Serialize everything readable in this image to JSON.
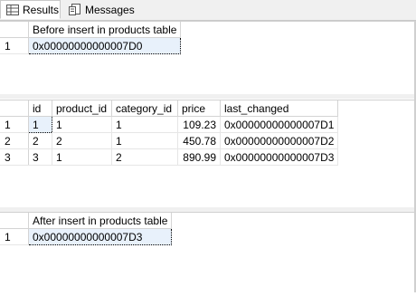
{
  "tabs": [
    {
      "label": "Results"
    },
    {
      "label": "Messages"
    }
  ],
  "grid1": {
    "header": "Before insert in products table",
    "rows": [
      {
        "rownum": "1",
        "value": "0x00000000000007D0"
      }
    ]
  },
  "grid2": {
    "columns": [
      "id",
      "product_id",
      "category_id",
      "price",
      "last_changed"
    ],
    "rows": [
      {
        "rownum": "1",
        "id": "1",
        "product_id": "1",
        "category_id": "1",
        "price": "109.23",
        "last_changed": "0x00000000000007D1"
      },
      {
        "rownum": "2",
        "id": "2",
        "product_id": "2",
        "category_id": "1",
        "price": "450.78",
        "last_changed": "0x00000000000007D2"
      },
      {
        "rownum": "3",
        "id": "3",
        "product_id": "1",
        "category_id": "2",
        "price": "890.99",
        "last_changed": "0x00000000000007D3"
      }
    ]
  },
  "grid3": {
    "header": "After insert in products table",
    "rows": [
      {
        "rownum": "1",
        "value": "0x00000000000007D3"
      }
    ]
  }
}
